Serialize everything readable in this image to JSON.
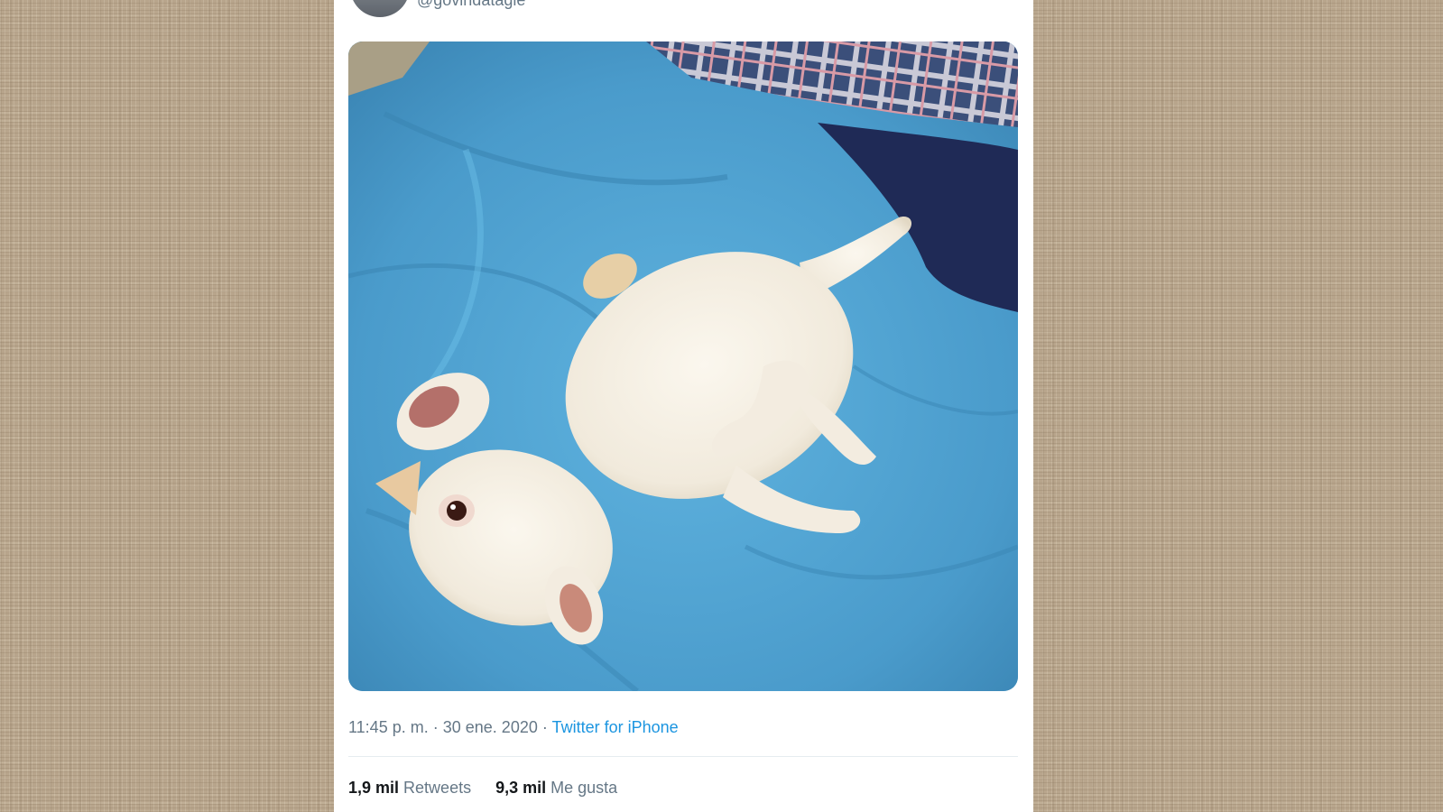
{
  "tweet": {
    "handle": "@govindatagle",
    "time": "11:45 p. m.",
    "separator": "·",
    "date": "30 ene. 2020",
    "source": "Twitter for iPhone",
    "image_description_icon": "photo-white-dog-on-blue-blanket",
    "stats": {
      "retweets_count": "1,9 mil",
      "retweets_label": "Retweets",
      "likes_count": "9,3 mil",
      "likes_label": "Me gusta"
    }
  },
  "colors": {
    "background_texture": "#b8a58c",
    "card": "#ffffff",
    "muted_text": "#657786",
    "link": "#1b95e0",
    "strong_text": "#14171a",
    "divider": "#e6ecf0"
  }
}
